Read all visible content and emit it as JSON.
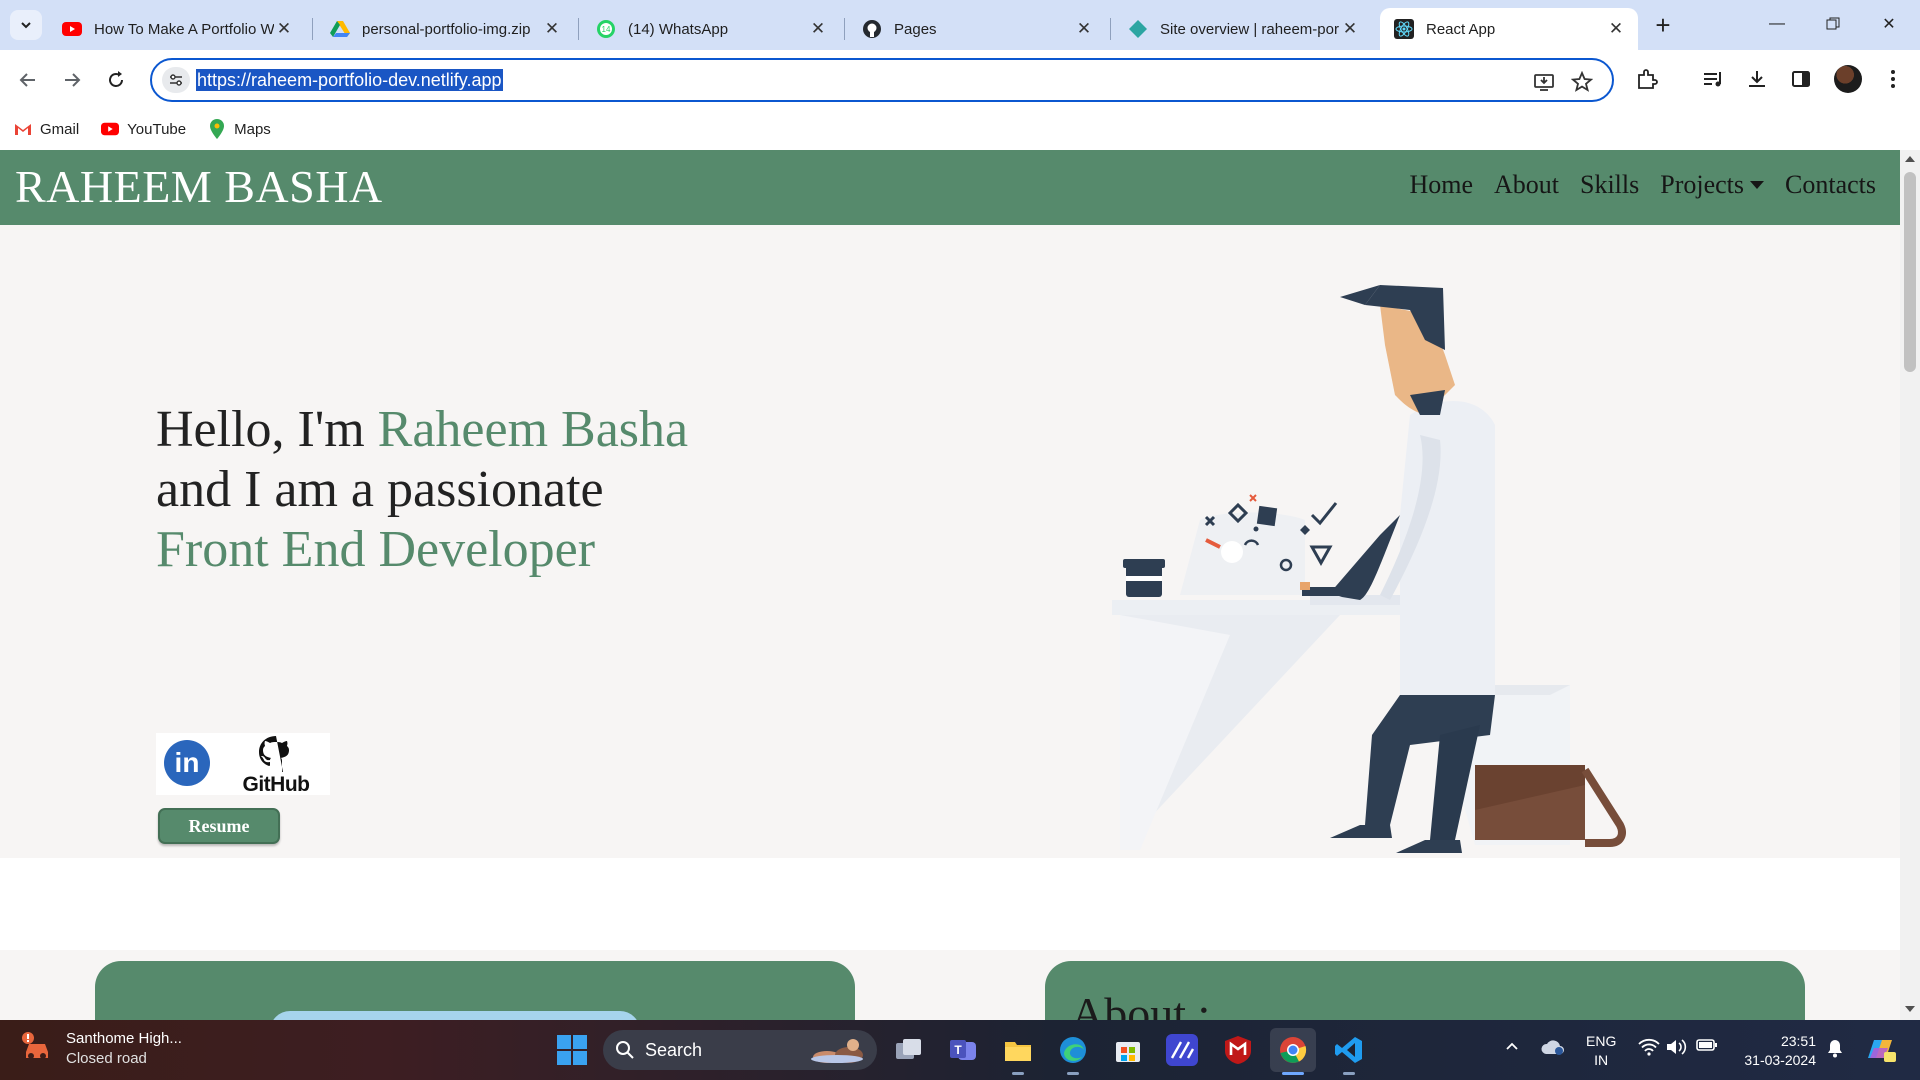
{
  "browser": {
    "tabs": [
      {
        "title": "How To Make A Portfolio W",
        "icon": "youtube-icon"
      },
      {
        "title": "personal-portfolio-img.zip",
        "icon": "google-drive-icon"
      },
      {
        "title": "(14) WhatsApp",
        "icon": "whatsapp-icon"
      },
      {
        "title": "Pages",
        "icon": "github-icon"
      },
      {
        "title": "Site overview | raheem-por",
        "icon": "netlify-icon"
      },
      {
        "title": "React App",
        "icon": "react-icon",
        "active": true
      }
    ],
    "new_tab": "+",
    "url": "https://raheem-portfolio-dev.netlify.app",
    "bookmarks": [
      {
        "label": "Gmail",
        "icon": "gmail-icon"
      },
      {
        "label": "YouTube",
        "icon": "youtube-icon"
      },
      {
        "label": "Maps",
        "icon": "maps-icon"
      }
    ]
  },
  "site": {
    "brand": "RAHEEM BASHA",
    "nav": [
      "Home",
      "About",
      "Skills",
      "Projects",
      "Contacts"
    ],
    "hero": {
      "greeting": "Hello, I'm ",
      "name": "Raheem Basha",
      "line2": "and I am a passionate",
      "role": "Front End Developer",
      "linkedin_letters": "in",
      "github_label": "GitHub",
      "resume_label": "Resume"
    },
    "about_title": "About :"
  },
  "taskbar": {
    "weather_title": "Santhome High...",
    "weather_subtitle": "Closed road",
    "search_label": "Search",
    "language": "ENG",
    "region": "IN",
    "time": "23:51",
    "date": "31-03-2024"
  },
  "colors": {
    "accent_green": "#568a6c",
    "hero_bg": "#f7f5f4",
    "chrome_blue": "#0b57d0"
  }
}
